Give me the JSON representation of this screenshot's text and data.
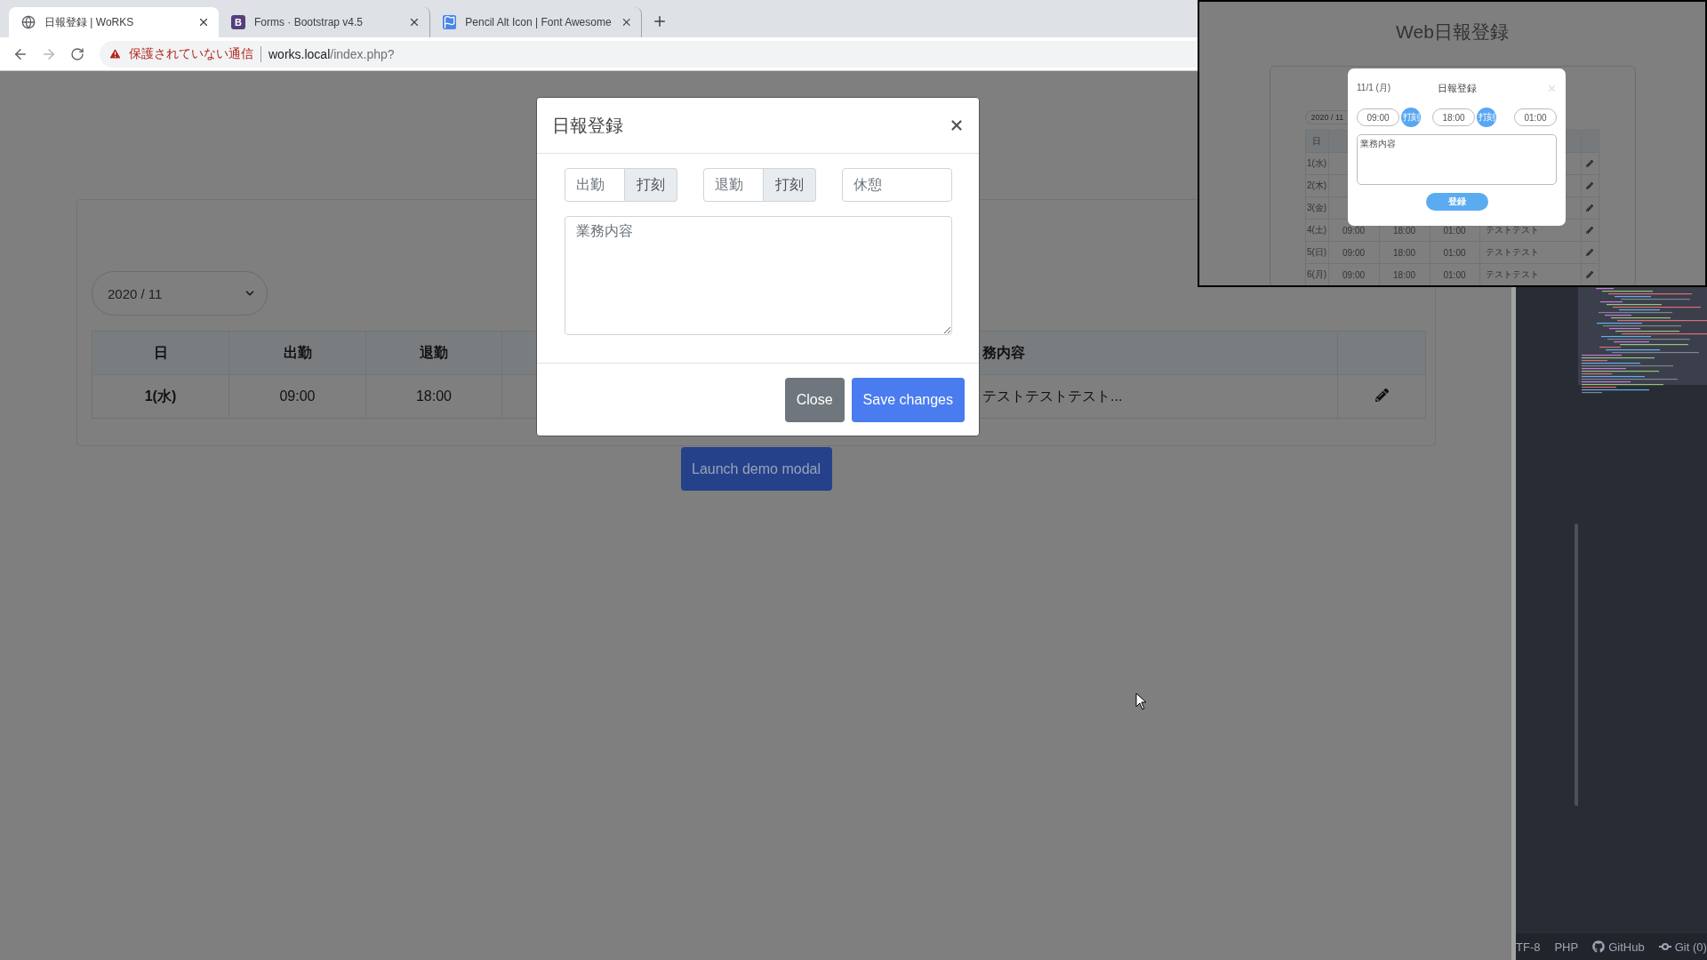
{
  "browser": {
    "tabs": [
      {
        "kind": "globe",
        "title": "日報登録 | WoRKS",
        "selected": true
      },
      {
        "kind": "letter",
        "favicon_text": "B",
        "title": "Forms · Bootstrap v4.5",
        "selected": false
      },
      {
        "kind": "flag",
        "title": "Pencil Alt Icon | Font Awesome",
        "selected": false
      }
    ],
    "forward_disabled": true,
    "security_warning": "保護されていない通信",
    "url_host": "works.local",
    "url_path": "/index.php?"
  },
  "page": {
    "month_select": "2020 / 11",
    "table": {
      "columns": [
        "日",
        "出勤",
        "退勤"
      ],
      "column_5_heading": "務内容",
      "rows": [
        {
          "day": "1(水)",
          "start": "09:00",
          "end": "18:00",
          "content": "テストテストテスト..."
        }
      ]
    },
    "launch_button": "Launch demo modal"
  },
  "modal": {
    "title": "日報登録",
    "start_placeholder": "出勤",
    "start_stamp": "打刻",
    "end_placeholder": "退勤",
    "end_stamp": "打刻",
    "break_placeholder": "休憩",
    "content_placeholder": "業務内容",
    "buttons": [
      {
        "kind": "secondary",
        "label": "Close"
      },
      {
        "kind": "primary",
        "label": "Save changes"
      }
    ]
  },
  "preview": {
    "title": "Web日報登録",
    "month_select": "2020 / 11",
    "table": {
      "columns": [
        "日"
      ],
      "rows": [
        {
          "day": "1(水)"
        },
        {
          "day": "2(木)"
        },
        {
          "day": "3(金)"
        },
        {
          "day": "4(土)",
          "start": "09:00",
          "end": "18:00",
          "break": "01:00",
          "content": "テストテスト"
        },
        {
          "day": "5(日)",
          "start": "09:00",
          "end": "18:00",
          "break": "01:00",
          "content": "テストテスト"
        },
        {
          "day": "6(月)",
          "start": "09:00",
          "end": "18:00",
          "break": "01:00",
          "content": "テストテスト"
        }
      ]
    },
    "modal": {
      "date": "11/1 (月)",
      "title": "日報登録",
      "start": "09:00",
      "start_stamp": "打刻",
      "end": "18:00",
      "end_stamp": "打刻",
      "break": "01:00",
      "content_placeholder": "業務内容",
      "submit": "登録"
    }
  },
  "editor": {
    "status_items": [
      {
        "kind": "text",
        "label": "TF-8"
      },
      {
        "kind": "text",
        "label": "PHP"
      },
      {
        "kind": "github",
        "label": "GitHub"
      },
      {
        "kind": "git",
        "label": "Git (0)"
      }
    ]
  }
}
